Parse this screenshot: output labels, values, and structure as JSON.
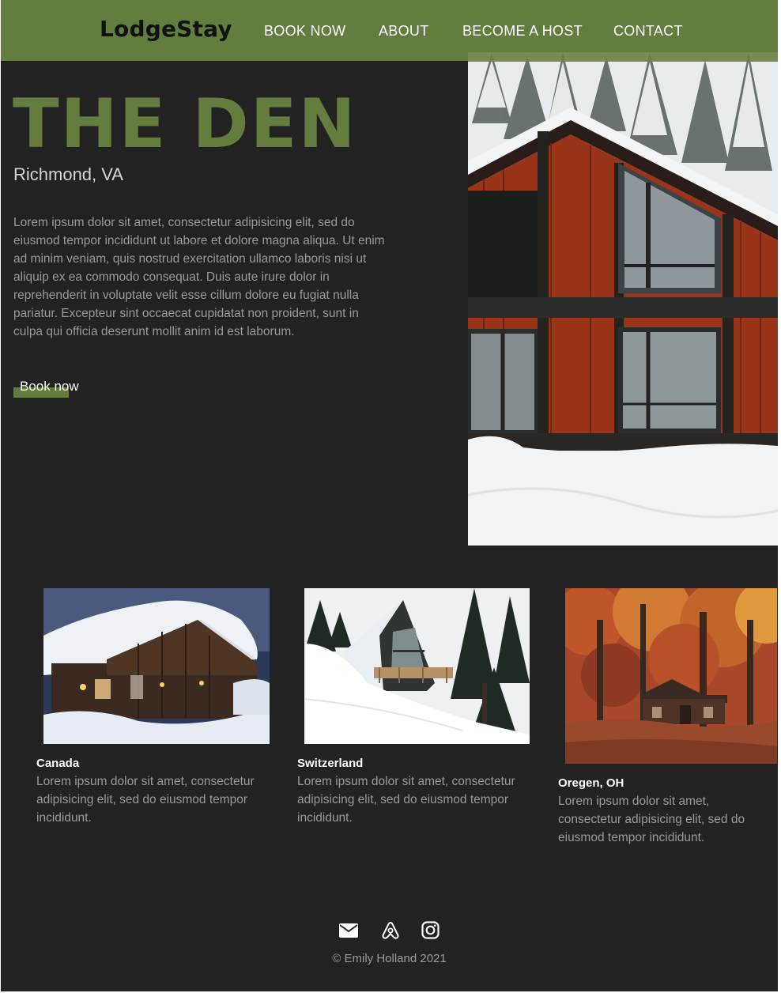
{
  "nav": {
    "brand": "LodgeStay",
    "links": [
      "BOOK NOW",
      "ABOUT",
      "BECOME A HOST",
      "CONTACT"
    ]
  },
  "hero": {
    "title": "THE DEN",
    "location": "Richmond, VA",
    "description": "Lorem ipsum dolor sit amet, consectetur adipisicing elit, sed do eiusmod tempor incididunt ut labore et dolore magna aliqua. Ut enim ad minim veniam, quis nostrud exercitation ullamco laboris nisi ut aliquip ex ea commodo consequat. Duis aute irure dolor in reprehenderit in voluptate velit esse cillum dolore eu fugiat nulla pariatur. Excepteur sint occaecat cupidatat non proident, sunt in culpa qui officia deserunt mollit anim id est laborum.",
    "button_label": "Book now"
  },
  "cards": [
    {
      "title": "Canada",
      "description": "Lorem ipsum dolor sit amet, consectetur adipisicing elit, sed do eiusmod tempor incididunt."
    },
    {
      "title": "Switzerland",
      "description": "Lorem ipsum dolor sit amet, consectetur adipisicing elit, sed do eiusmod tempor incididunt."
    },
    {
      "title": "Oregen, OH",
      "description": "Lorem ipsum dolor sit amet, consectetur adipisicing elit, sed do eiusmod tempor incididunt."
    }
  ],
  "footer": {
    "icons": [
      "envelope-icon",
      "airbnb-icon",
      "instagram-icon"
    ],
    "copyright": "© Emily Holland 2021"
  },
  "colors": {
    "accent": "#627d3d",
    "background": "#222222"
  }
}
